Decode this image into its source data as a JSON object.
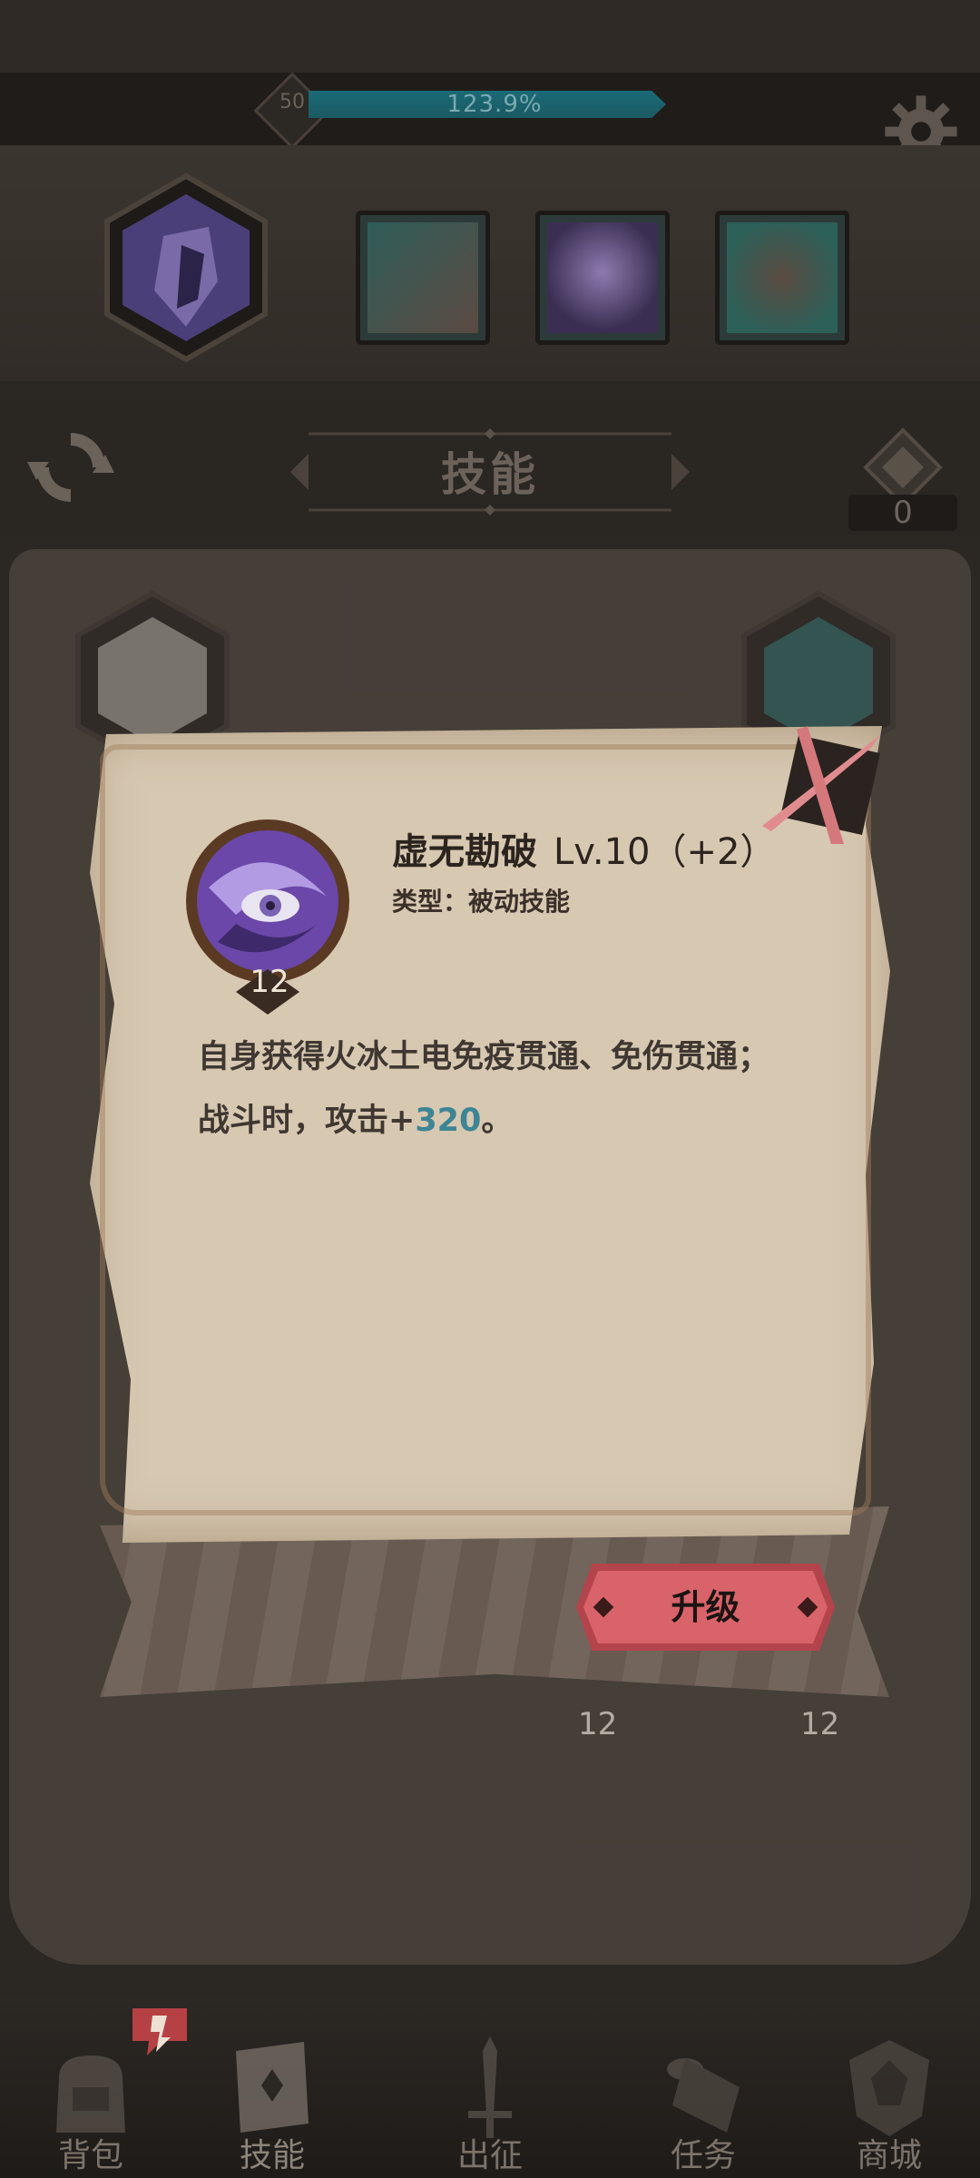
{
  "top_bar": {
    "player_level": "50",
    "xp_percent_text": "123.9%",
    "xp_fill_fraction": 0.96
  },
  "header": {
    "title": "技能",
    "token_count": "0"
  },
  "skill_popup": {
    "name": "虚无勘破",
    "level_text": "Lv.10（+2）",
    "type_text": "类型：被动技能",
    "icon_level": "12",
    "description_prefix": "自身获得火冰土电免疫贯通、免伤贯通；战斗时，攻击+",
    "description_value": "320",
    "description_suffix": "。",
    "upgrade_label": "升级"
  },
  "background_grid": {
    "visible_levels": [
      "12",
      "12"
    ]
  },
  "bottom_nav": {
    "items": [
      {
        "label": "背包",
        "icon": "backpack-icon"
      },
      {
        "label": "技能",
        "icon": "skill-book-icon"
      },
      {
        "label": "出征",
        "icon": "sword-icon"
      },
      {
        "label": "任务",
        "icon": "scroll-icon"
      },
      {
        "label": "商城",
        "icon": "shop-crest-icon"
      }
    ],
    "active_index": 1
  },
  "colors": {
    "xp_bar": "#1a6a76",
    "highlight_number": "#3d8595",
    "upgrade_button": "#d9636a",
    "parchment": "#d7c8b1"
  }
}
